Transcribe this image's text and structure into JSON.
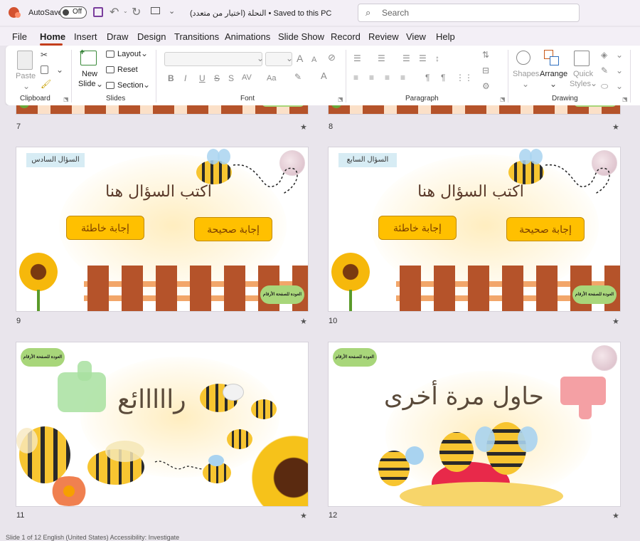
{
  "titlebar": {
    "autosave_label": "AutoSave",
    "autosave_state": "Off",
    "doc_title": "النحلة (اختيار من متعدد)  •  Saved to this PC",
    "search_placeholder": "Search"
  },
  "menu": {
    "items": [
      "File",
      "Home",
      "Insert",
      "Draw",
      "Design",
      "Transitions",
      "Animations",
      "Slide Show",
      "Record",
      "Review",
      "View",
      "Help"
    ],
    "active": "Home"
  },
  "ribbon": {
    "clipboard": {
      "paste": "Paste",
      "group": "Clipboard"
    },
    "slides": {
      "new_slide_1": "New",
      "new_slide_2": "Slide",
      "layout": "Layout",
      "reset": "Reset",
      "section": "Section",
      "group": "Slides"
    },
    "font": {
      "group": "Font",
      "bold": "B",
      "italic": "I",
      "underline": "U",
      "strike": "S",
      "spacing": "AV",
      "case": "Aa",
      "grow": "A",
      "shrink": "A"
    },
    "paragraph": {
      "group": "Paragraph"
    },
    "drawing": {
      "shapes": "Shapes",
      "arrange": "Arrange",
      "quick_1": "Quick",
      "quick_2": "Styles",
      "group": "Drawing"
    }
  },
  "slides": [
    {
      "number": "7",
      "star": "★"
    },
    {
      "number": "8",
      "star": "★"
    },
    {
      "number": "9",
      "star": "★",
      "label": "السؤال السادس",
      "title": "اكتب السؤال هنا",
      "wrong": "إجابة خاطئة",
      "right": "إجابة صحيحة",
      "back": "العودة للصفحة الأرقام"
    },
    {
      "number": "10",
      "star": "★",
      "label": "السؤال السابع",
      "title": "اكتب السؤال هنا",
      "wrong": "إجابة خاطئة",
      "right": "إجابة صحيحة",
      "back": "العودة للصفحة الأرقام"
    },
    {
      "number": "11",
      "star": "★",
      "big_text": "رااااائع",
      "back": "العودة للصفحة الأرقام"
    },
    {
      "number": "12",
      "star": "★",
      "big_text": "حاول مرة أخرى",
      "back": "العودة للصفحة الأرقام"
    }
  ],
  "status": {
    "text": "Slide 1 of 12    English (United States)    Accessibility: Investigate"
  },
  "colors": {
    "accent": "#c43e1c",
    "answer_fill": "#ffc000",
    "back_button": "#a8d67a",
    "fence": "#b5532a"
  }
}
